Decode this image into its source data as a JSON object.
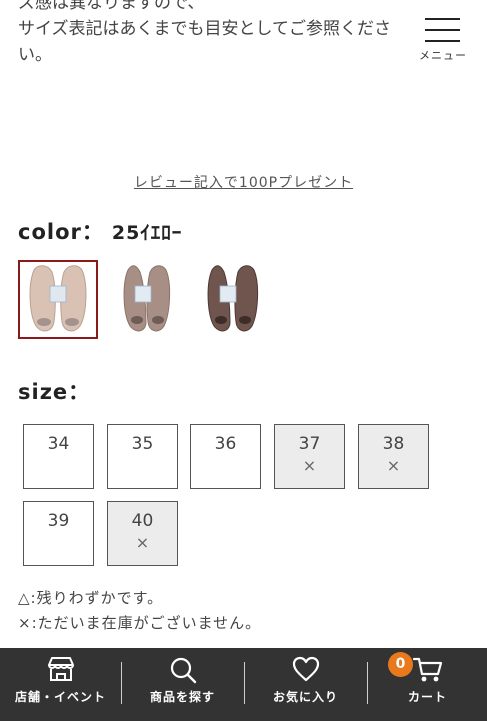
{
  "intro": {
    "line1": "ズ感は異なりますので、",
    "line2": "サイズ表記はあくまでも目安としてご参照くださ",
    "line3": "い。"
  },
  "header": {
    "menu_label": "メニュー",
    "menu_icon": "hamburger-icon"
  },
  "review_link": "レビュー記入で100Pプレゼント",
  "color": {
    "label": "color：",
    "selected": "25ｲｴﾛｰ",
    "swatches": [
      {
        "name": "beige-ballet-flats",
        "selected": true,
        "tint": "#d9c2b4"
      },
      {
        "name": "taupe-ballet-flats",
        "selected": false,
        "tint": "#a88f86"
      },
      {
        "name": "brown-ballet-flats",
        "selected": false,
        "tint": "#6f554d"
      }
    ]
  },
  "size": {
    "label": "size：",
    "options": [
      {
        "label": "34",
        "mark": "",
        "available": true
      },
      {
        "label": "35",
        "mark": "",
        "available": true
      },
      {
        "label": "36",
        "mark": "",
        "available": true
      },
      {
        "label": "37",
        "mark": "×",
        "available": false
      },
      {
        "label": "38",
        "mark": "×",
        "available": false
      },
      {
        "label": "39",
        "mark": "",
        "available": true
      },
      {
        "label": "40",
        "mark": "×",
        "available": false
      }
    ]
  },
  "legend": {
    "few": "△:残りわずかです。",
    "none": "×:ただいま在庫がございません。"
  },
  "bottom_nav": {
    "items": [
      {
        "label": "店舗・イベント",
        "icon": "store-icon"
      },
      {
        "label": "商品を探す",
        "icon": "search-icon"
      },
      {
        "label": "お気に入り",
        "icon": "heart-icon"
      },
      {
        "label": "カート",
        "icon": "cart-icon"
      }
    ],
    "cart_count": "0"
  },
  "colors": {
    "nav_bg": "#333333",
    "badge": "#e87a1d",
    "selected_border": "#8b1a1a",
    "unavailable_bg": "#ececec"
  }
}
